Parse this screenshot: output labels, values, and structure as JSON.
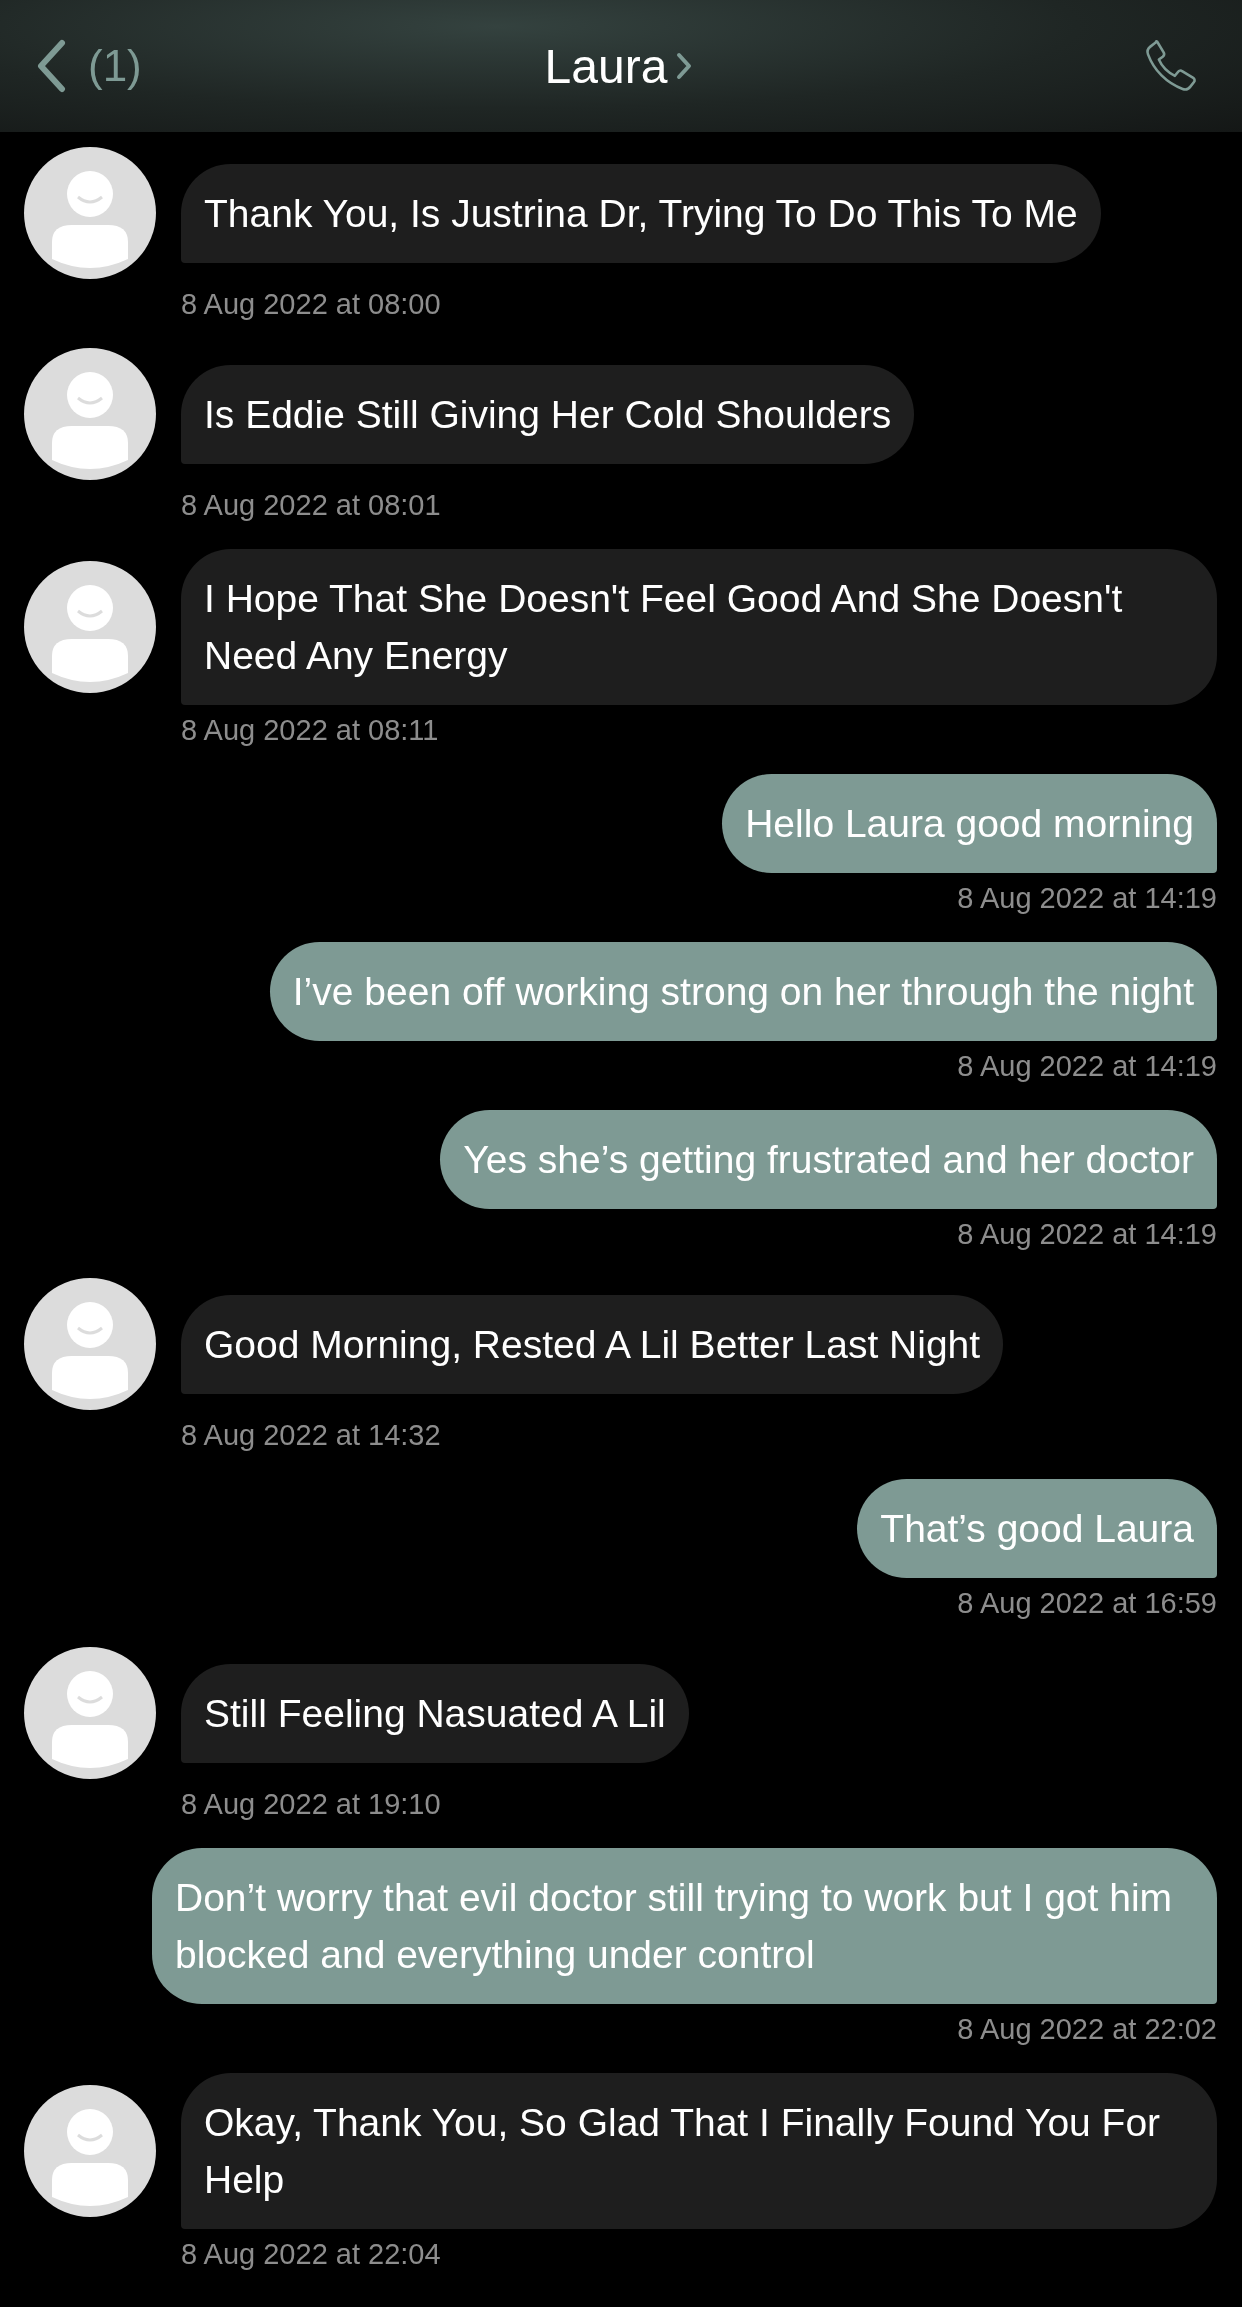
{
  "header": {
    "back_count": "(1)",
    "title": "Laura"
  },
  "messages": [
    {
      "kind": "received",
      "text": "Thank You, Is Justrina Dr, Trying To Do This To Me",
      "time": "8 Aug 2022 at 08:00"
    },
    {
      "kind": "received",
      "text": "Is Eddie Still Giving Her Cold Shoulders",
      "time": "8 Aug 2022 at 08:01"
    },
    {
      "kind": "received",
      "text": "I Hope That She Doesn't Feel Good And She Doesn't Need Any Energy",
      "time": "8 Aug 2022 at 08:11"
    },
    {
      "kind": "sent",
      "text": "Hello Laura good morning",
      "time": "8 Aug 2022 at 14:19"
    },
    {
      "kind": "sent",
      "text": "I’ve been off working strong on her through the night",
      "time": "8 Aug 2022 at 14:19"
    },
    {
      "kind": "sent",
      "text": "Yes she’s getting frustrated and her doctor",
      "time": "8 Aug 2022 at 14:19"
    },
    {
      "kind": "received",
      "text": "Good Morning, Rested A Lil Better Last Night",
      "time": "8 Aug 2022 at 14:32"
    },
    {
      "kind": "sent",
      "text": "That’s good Laura",
      "time": "8 Aug 2022 at 16:59"
    },
    {
      "kind": "received",
      "text": "Still Feeling Nasuated A Lil",
      "time": "8 Aug 2022 at 19:10"
    },
    {
      "kind": "sent",
      "text": "Don’t worry that evil doctor still trying to work but I got him blocked and everything under control",
      "time": "8 Aug 2022 at 22:02"
    },
    {
      "kind": "received",
      "text": "Okay, Thank You, So Glad That I Finally Found You For Help",
      "time": "8 Aug 2022 at 22:04"
    }
  ]
}
